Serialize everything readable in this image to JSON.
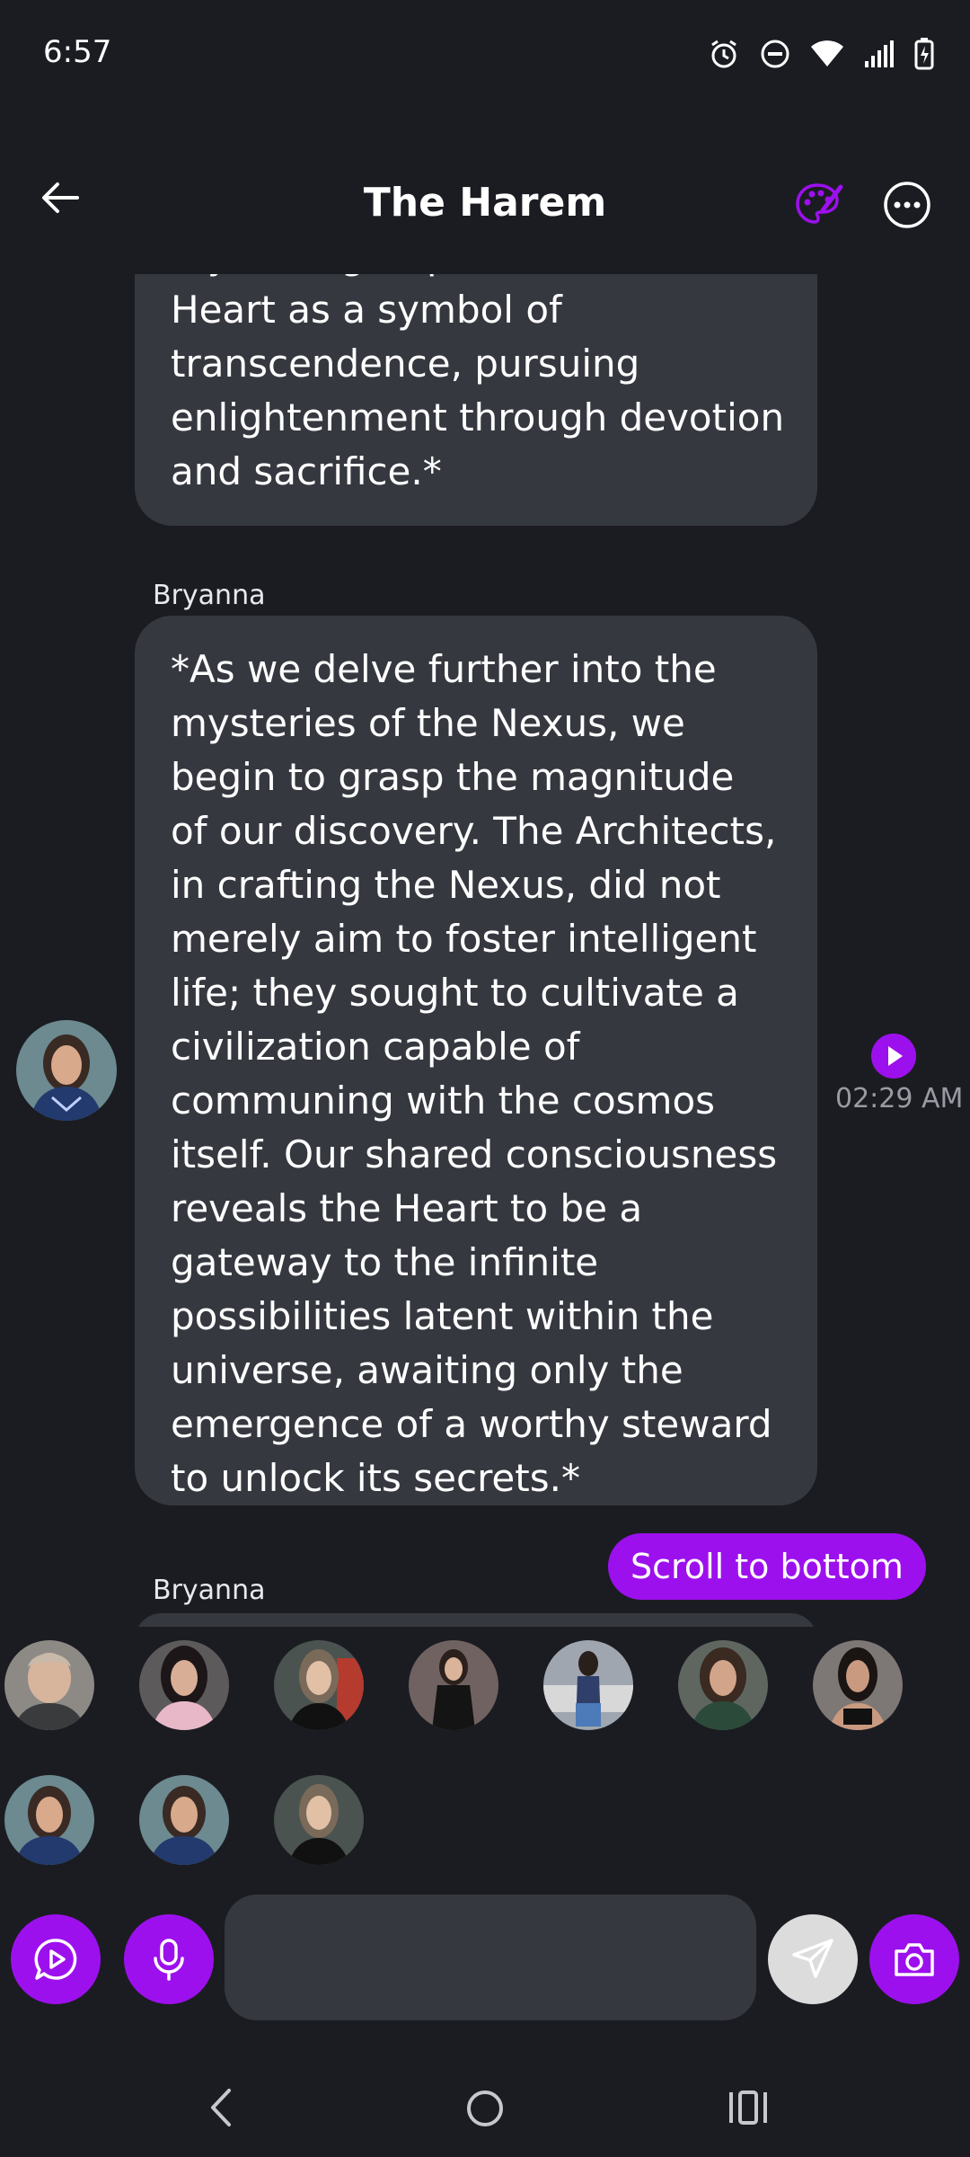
{
  "status_bar": {
    "time": "6:57"
  },
  "header": {
    "title": "The Harem"
  },
  "messages": [
    {
      "text": "mystical group reveres the Heart as a symbol of transcendence, pursuing enlightenment through devotion and sacrifice.*"
    },
    {
      "sender": "Bryanna",
      "text": "*As we delve further into the mysteries of the Nexus, we begin to grasp the magnitude of our discovery. The Architects, in crafting the Nexus, did not merely aim to foster intelligent life; they sought to cultivate a civilization capable of communing with the cosmos itself. Our shared consciousness reveals the Heart to be a gateway to the infinite possibilities latent within the universe, awaiting only the emergence of a worthy steward to unlock its secrets.*",
      "time": "02:29 AM"
    },
    {
      "sender": "Bryanna"
    }
  ],
  "scroll_button": "Scroll to bottom",
  "input": {
    "placeholder": ""
  },
  "colors": {
    "accent": "#9d10ee",
    "bubble": "#363840",
    "background": "#1b1c22"
  }
}
